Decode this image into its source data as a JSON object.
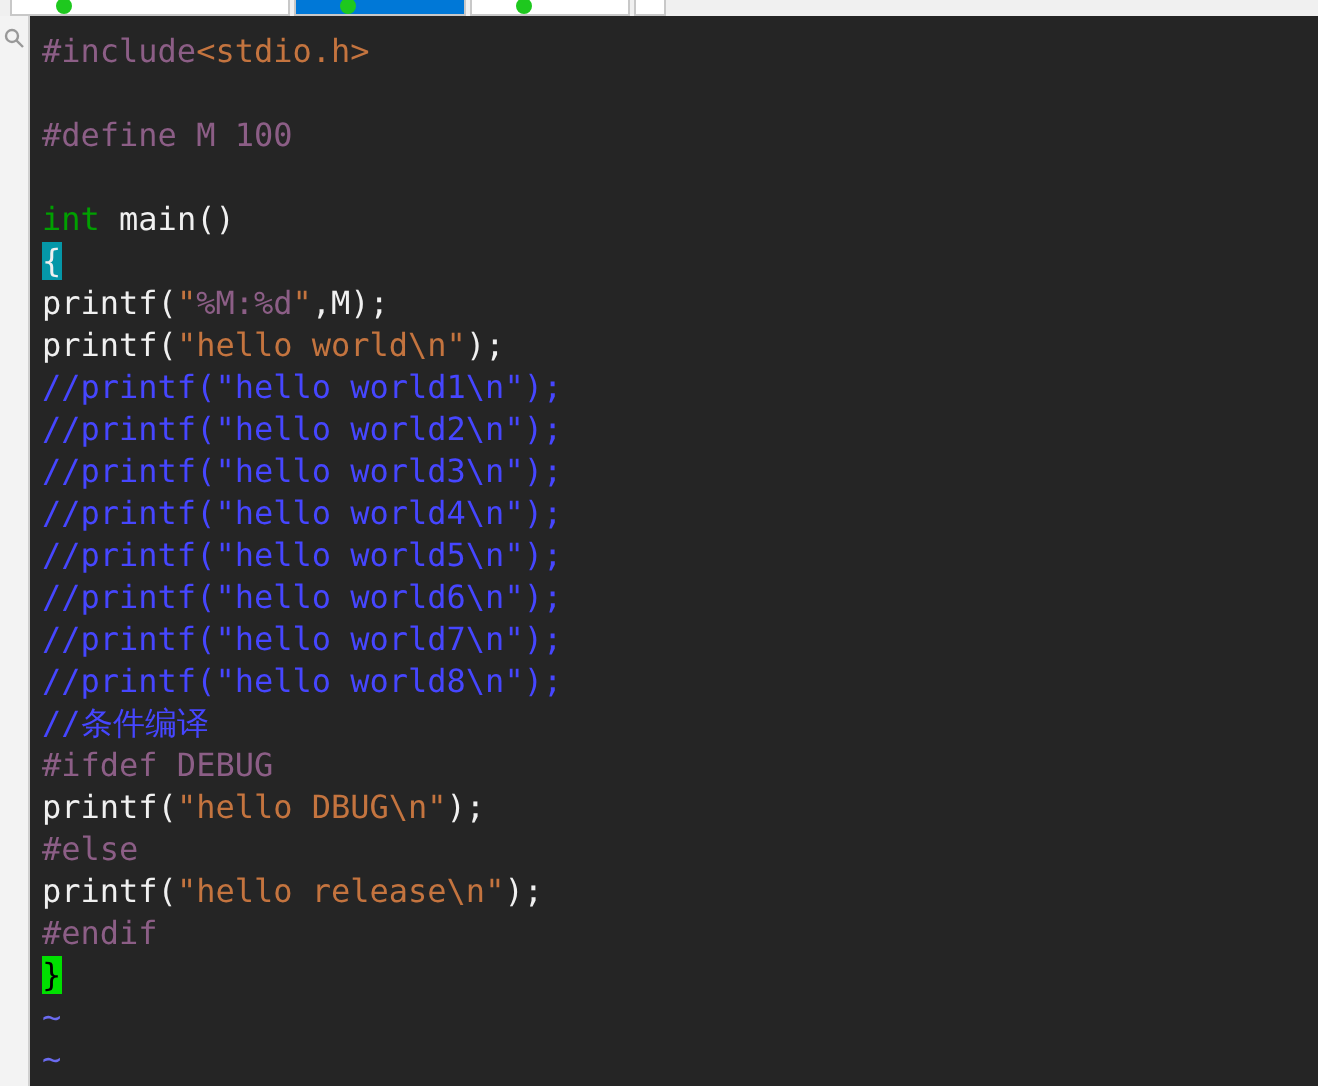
{
  "tabs": [
    {
      "selected": false,
      "dot": true
    },
    {
      "selected": true,
      "dot": true
    },
    {
      "selected": false,
      "dot": true
    },
    {
      "selected": false,
      "dot": false
    }
  ],
  "lines": [
    {
      "kind": "code",
      "tokens": [
        {
          "kind": "preproc",
          "text": "#include"
        },
        {
          "kind": "string",
          "text": "<stdio.h>"
        }
      ]
    },
    {
      "kind": "blank"
    },
    {
      "kind": "code",
      "tokens": [
        {
          "kind": "preproc",
          "text": "#define M 100"
        }
      ]
    },
    {
      "kind": "blank"
    },
    {
      "kind": "code",
      "tokens": [
        {
          "kind": "type",
          "text": "int"
        },
        {
          "kind": "normal",
          "text": " main()"
        }
      ]
    },
    {
      "kind": "code",
      "tokens": [
        {
          "kind": "match",
          "text": "{"
        }
      ]
    },
    {
      "kind": "code",
      "tokens": [
        {
          "kind": "normal",
          "text": "printf("
        },
        {
          "kind": "string",
          "text": "\""
        },
        {
          "kind": "special",
          "text": "%M:%d"
        },
        {
          "kind": "string",
          "text": "\""
        },
        {
          "kind": "normal",
          "text": ",M);"
        }
      ]
    },
    {
      "kind": "code",
      "tokens": [
        {
          "kind": "normal",
          "text": "printf("
        },
        {
          "kind": "string",
          "text": "\"hello world\\n\""
        },
        {
          "kind": "normal",
          "text": ");"
        }
      ]
    },
    {
      "kind": "code",
      "tokens": [
        {
          "kind": "comment",
          "text": "//printf(\"hello world1\\n\");"
        }
      ]
    },
    {
      "kind": "code",
      "tokens": [
        {
          "kind": "comment",
          "text": "//printf(\"hello world2\\n\");"
        }
      ]
    },
    {
      "kind": "code",
      "tokens": [
        {
          "kind": "comment",
          "text": "//printf(\"hello world3\\n\");"
        }
      ]
    },
    {
      "kind": "code",
      "tokens": [
        {
          "kind": "comment",
          "text": "//printf(\"hello world4\\n\");"
        }
      ]
    },
    {
      "kind": "code",
      "tokens": [
        {
          "kind": "comment",
          "text": "//printf(\"hello world5\\n\");"
        }
      ]
    },
    {
      "kind": "code",
      "tokens": [
        {
          "kind": "comment",
          "text": "//printf(\"hello world6\\n\");"
        }
      ]
    },
    {
      "kind": "code",
      "tokens": [
        {
          "kind": "comment",
          "text": "//printf(\"hello world7\\n\");"
        }
      ]
    },
    {
      "kind": "code",
      "tokens": [
        {
          "kind": "comment",
          "text": "//printf(\"hello world8\\n\");"
        }
      ]
    },
    {
      "kind": "code",
      "tokens": [
        {
          "kind": "comment",
          "text": "//条件编译"
        }
      ]
    },
    {
      "kind": "code",
      "tokens": [
        {
          "kind": "preproc",
          "text": "#ifdef DEBUG"
        }
      ]
    },
    {
      "kind": "code",
      "tokens": [
        {
          "kind": "normal",
          "text": "printf("
        },
        {
          "kind": "string",
          "text": "\"hello DBUG\\n\""
        },
        {
          "kind": "normal",
          "text": ");"
        }
      ]
    },
    {
      "kind": "code",
      "tokens": [
        {
          "kind": "preproc",
          "text": "#else"
        }
      ]
    },
    {
      "kind": "code",
      "tokens": [
        {
          "kind": "normal",
          "text": "printf("
        },
        {
          "kind": "string",
          "text": "\"hello release\\n\""
        },
        {
          "kind": "normal",
          "text": ");"
        }
      ]
    },
    {
      "kind": "code",
      "tokens": [
        {
          "kind": "preproc",
          "text": "#endif"
        }
      ]
    },
    {
      "kind": "code",
      "tokens": [
        {
          "kind": "cursor",
          "text": "}"
        }
      ]
    },
    {
      "kind": "code",
      "tokens": [
        {
          "kind": "tilde",
          "text": "~"
        }
      ]
    },
    {
      "kind": "code",
      "tokens": [
        {
          "kind": "tilde",
          "text": "~"
        }
      ]
    }
  ]
}
